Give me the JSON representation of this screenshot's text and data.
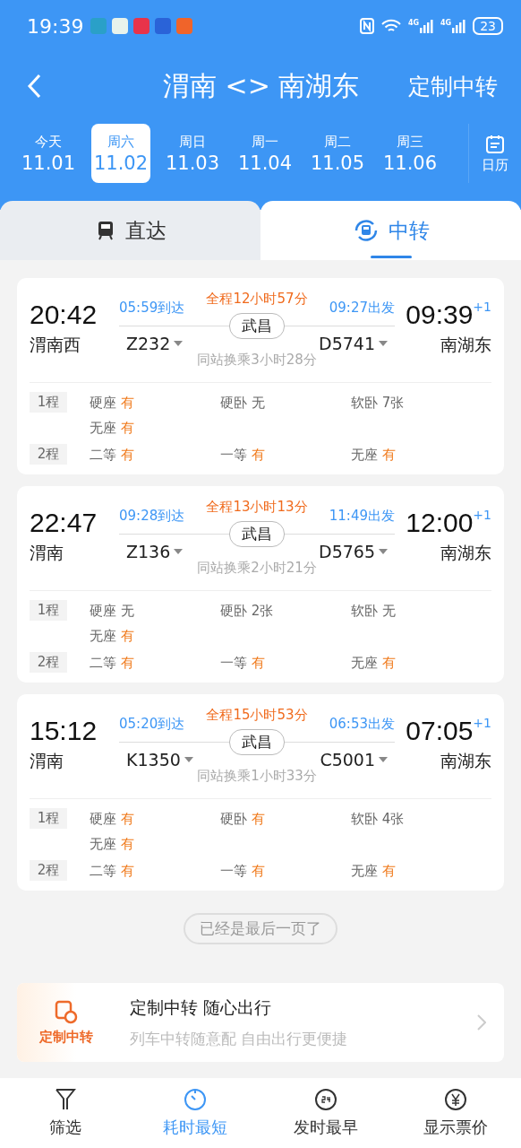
{
  "status_bar": {
    "time": "19:39",
    "network": [
      "4G",
      "4G"
    ],
    "battery": "23"
  },
  "header": {
    "title": "渭南 <> 南湖东",
    "action": "定制中转"
  },
  "dates": [
    {
      "weekday": "今天",
      "date": "11.01",
      "selected": false
    },
    {
      "weekday": "周六",
      "date": "11.02",
      "selected": true
    },
    {
      "weekday": "周日",
      "date": "11.03",
      "selected": false
    },
    {
      "weekday": "周一",
      "date": "11.04",
      "selected": false
    },
    {
      "weekday": "周二",
      "date": "11.05",
      "selected": false
    },
    {
      "weekday": "周三",
      "date": "11.06",
      "selected": false
    }
  ],
  "calendar_label": "日历",
  "tabs": [
    {
      "label": "直达",
      "kind": "direct",
      "selected": false
    },
    {
      "label": "中转",
      "kind": "transfer",
      "selected": true
    }
  ],
  "trips": [
    {
      "depart_time": "20:42",
      "depart_station": "渭南西",
      "arrive_time": "09:39",
      "arrive_day": "+1",
      "arrive_station": "南湖东",
      "total": "全程12小时57分",
      "leg1_arrive": "05:59到达",
      "leg1_train": "Z232",
      "leg2_depart": "09:27出发",
      "leg2_train": "D5741",
      "transfer_station": "武昌",
      "transfer_note": "同站换乘3小时28分",
      "legs": [
        {
          "label": "1程",
          "seats": [
            {
              "name": "硬座",
              "value": "有",
              "available": true
            },
            {
              "name": "硬卧",
              "value": "无",
              "available": false
            },
            {
              "name": "软卧",
              "value": "7张",
              "available": false
            },
            {
              "name": "无座",
              "value": "有",
              "available": true
            }
          ]
        },
        {
          "label": "2程",
          "seats": [
            {
              "name": "二等",
              "value": "有",
              "available": true
            },
            {
              "name": "一等",
              "value": "有",
              "available": true
            },
            {
              "name": "无座",
              "value": "有",
              "available": true
            }
          ]
        }
      ]
    },
    {
      "depart_time": "22:47",
      "depart_station": "渭南",
      "arrive_time": "12:00",
      "arrive_day": "+1",
      "arrive_station": "南湖东",
      "total": "全程13小时13分",
      "leg1_arrive": "09:28到达",
      "leg1_train": "Z136",
      "leg2_depart": "11:49出发",
      "leg2_train": "D5765",
      "transfer_station": "武昌",
      "transfer_note": "同站换乘2小时21分",
      "legs": [
        {
          "label": "1程",
          "seats": [
            {
              "name": "硬座",
              "value": "无",
              "available": false
            },
            {
              "name": "硬卧",
              "value": "2张",
              "available": false
            },
            {
              "name": "软卧",
              "value": "无",
              "available": false
            },
            {
              "name": "无座",
              "value": "有",
              "available": true
            }
          ]
        },
        {
          "label": "2程",
          "seats": [
            {
              "name": "二等",
              "value": "有",
              "available": true
            },
            {
              "name": "一等",
              "value": "有",
              "available": true
            },
            {
              "name": "无座",
              "value": "有",
              "available": true
            }
          ]
        }
      ]
    },
    {
      "depart_time": "15:12",
      "depart_station": "渭南",
      "arrive_time": "07:05",
      "arrive_day": "+1",
      "arrive_station": "南湖东",
      "total": "全程15小时53分",
      "leg1_arrive": "05:20到达",
      "leg1_train": "K1350",
      "leg2_depart": "06:53出发",
      "leg2_train": "C5001",
      "transfer_station": "武昌",
      "transfer_note": "同站换乘1小时33分",
      "legs": [
        {
          "label": "1程",
          "seats": [
            {
              "name": "硬座",
              "value": "有",
              "available": true
            },
            {
              "name": "硬卧",
              "value": "有",
              "available": true
            },
            {
              "name": "软卧",
              "value": "4张",
              "available": false
            },
            {
              "name": "无座",
              "value": "有",
              "available": true
            }
          ]
        },
        {
          "label": "2程",
          "seats": [
            {
              "name": "二等",
              "value": "有",
              "available": true
            },
            {
              "name": "一等",
              "value": "有",
              "available": true
            },
            {
              "name": "无座",
              "value": "有",
              "available": true
            }
          ]
        }
      ]
    }
  ],
  "end_note": "已经是最后一页了",
  "promo": {
    "badge": "定制中转",
    "title": "定制中转 随心出行",
    "subtitle": "列车中转随意配 自由出行更便捷"
  },
  "bottom_nav": [
    {
      "label": "筛选",
      "kind": "filter",
      "selected": false
    },
    {
      "label": "耗时最短",
      "kind": "duration",
      "selected": true
    },
    {
      "label": "发时最早",
      "kind": "earliest",
      "selected": false
    },
    {
      "label": "显示票价",
      "kind": "price",
      "selected": false
    }
  ]
}
